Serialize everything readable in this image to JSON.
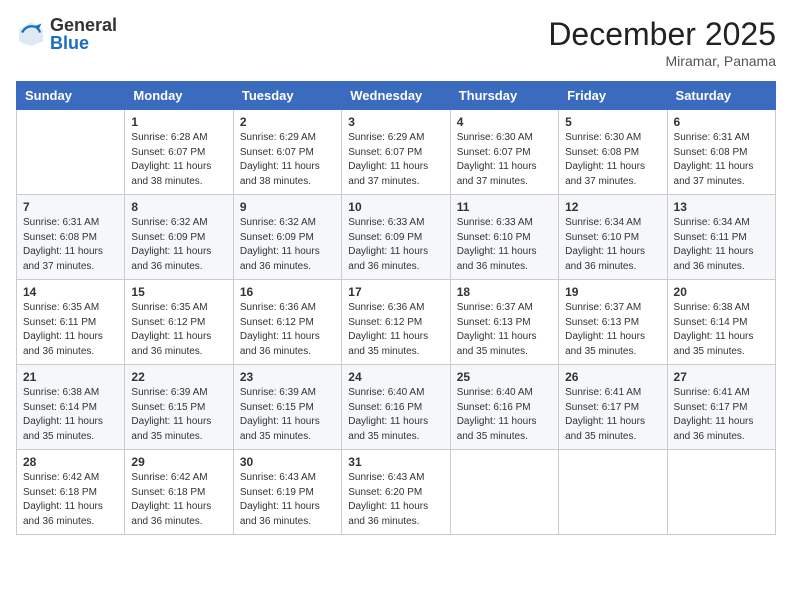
{
  "header": {
    "logo_general": "General",
    "logo_blue": "Blue",
    "month_title": "December 2025",
    "location": "Miramar, Panama"
  },
  "days_of_week": [
    "Sunday",
    "Monday",
    "Tuesday",
    "Wednesday",
    "Thursday",
    "Friday",
    "Saturday"
  ],
  "weeks": [
    [
      {
        "day": "",
        "info": ""
      },
      {
        "day": "1",
        "info": "Sunrise: 6:28 AM\nSunset: 6:07 PM\nDaylight: 11 hours and 38 minutes."
      },
      {
        "day": "2",
        "info": "Sunrise: 6:29 AM\nSunset: 6:07 PM\nDaylight: 11 hours and 38 minutes."
      },
      {
        "day": "3",
        "info": "Sunrise: 6:29 AM\nSunset: 6:07 PM\nDaylight: 11 hours and 37 minutes."
      },
      {
        "day": "4",
        "info": "Sunrise: 6:30 AM\nSunset: 6:07 PM\nDaylight: 11 hours and 37 minutes."
      },
      {
        "day": "5",
        "info": "Sunrise: 6:30 AM\nSunset: 6:08 PM\nDaylight: 11 hours and 37 minutes."
      },
      {
        "day": "6",
        "info": "Sunrise: 6:31 AM\nSunset: 6:08 PM\nDaylight: 11 hours and 37 minutes."
      }
    ],
    [
      {
        "day": "7",
        "info": "Sunrise: 6:31 AM\nSunset: 6:08 PM\nDaylight: 11 hours and 37 minutes."
      },
      {
        "day": "8",
        "info": "Sunrise: 6:32 AM\nSunset: 6:09 PM\nDaylight: 11 hours and 36 minutes."
      },
      {
        "day": "9",
        "info": "Sunrise: 6:32 AM\nSunset: 6:09 PM\nDaylight: 11 hours and 36 minutes."
      },
      {
        "day": "10",
        "info": "Sunrise: 6:33 AM\nSunset: 6:09 PM\nDaylight: 11 hours and 36 minutes."
      },
      {
        "day": "11",
        "info": "Sunrise: 6:33 AM\nSunset: 6:10 PM\nDaylight: 11 hours and 36 minutes."
      },
      {
        "day": "12",
        "info": "Sunrise: 6:34 AM\nSunset: 6:10 PM\nDaylight: 11 hours and 36 minutes."
      },
      {
        "day": "13",
        "info": "Sunrise: 6:34 AM\nSunset: 6:11 PM\nDaylight: 11 hours and 36 minutes."
      }
    ],
    [
      {
        "day": "14",
        "info": "Sunrise: 6:35 AM\nSunset: 6:11 PM\nDaylight: 11 hours and 36 minutes."
      },
      {
        "day": "15",
        "info": "Sunrise: 6:35 AM\nSunset: 6:12 PM\nDaylight: 11 hours and 36 minutes."
      },
      {
        "day": "16",
        "info": "Sunrise: 6:36 AM\nSunset: 6:12 PM\nDaylight: 11 hours and 36 minutes."
      },
      {
        "day": "17",
        "info": "Sunrise: 6:36 AM\nSunset: 6:12 PM\nDaylight: 11 hours and 35 minutes."
      },
      {
        "day": "18",
        "info": "Sunrise: 6:37 AM\nSunset: 6:13 PM\nDaylight: 11 hours and 35 minutes."
      },
      {
        "day": "19",
        "info": "Sunrise: 6:37 AM\nSunset: 6:13 PM\nDaylight: 11 hours and 35 minutes."
      },
      {
        "day": "20",
        "info": "Sunrise: 6:38 AM\nSunset: 6:14 PM\nDaylight: 11 hours and 35 minutes."
      }
    ],
    [
      {
        "day": "21",
        "info": "Sunrise: 6:38 AM\nSunset: 6:14 PM\nDaylight: 11 hours and 35 minutes."
      },
      {
        "day": "22",
        "info": "Sunrise: 6:39 AM\nSunset: 6:15 PM\nDaylight: 11 hours and 35 minutes."
      },
      {
        "day": "23",
        "info": "Sunrise: 6:39 AM\nSunset: 6:15 PM\nDaylight: 11 hours and 35 minutes."
      },
      {
        "day": "24",
        "info": "Sunrise: 6:40 AM\nSunset: 6:16 PM\nDaylight: 11 hours and 35 minutes."
      },
      {
        "day": "25",
        "info": "Sunrise: 6:40 AM\nSunset: 6:16 PM\nDaylight: 11 hours and 35 minutes."
      },
      {
        "day": "26",
        "info": "Sunrise: 6:41 AM\nSunset: 6:17 PM\nDaylight: 11 hours and 35 minutes."
      },
      {
        "day": "27",
        "info": "Sunrise: 6:41 AM\nSunset: 6:17 PM\nDaylight: 11 hours and 36 minutes."
      }
    ],
    [
      {
        "day": "28",
        "info": "Sunrise: 6:42 AM\nSunset: 6:18 PM\nDaylight: 11 hours and 36 minutes."
      },
      {
        "day": "29",
        "info": "Sunrise: 6:42 AM\nSunset: 6:18 PM\nDaylight: 11 hours and 36 minutes."
      },
      {
        "day": "30",
        "info": "Sunrise: 6:43 AM\nSunset: 6:19 PM\nDaylight: 11 hours and 36 minutes."
      },
      {
        "day": "31",
        "info": "Sunrise: 6:43 AM\nSunset: 6:20 PM\nDaylight: 11 hours and 36 minutes."
      },
      {
        "day": "",
        "info": ""
      },
      {
        "day": "",
        "info": ""
      },
      {
        "day": "",
        "info": ""
      }
    ]
  ]
}
